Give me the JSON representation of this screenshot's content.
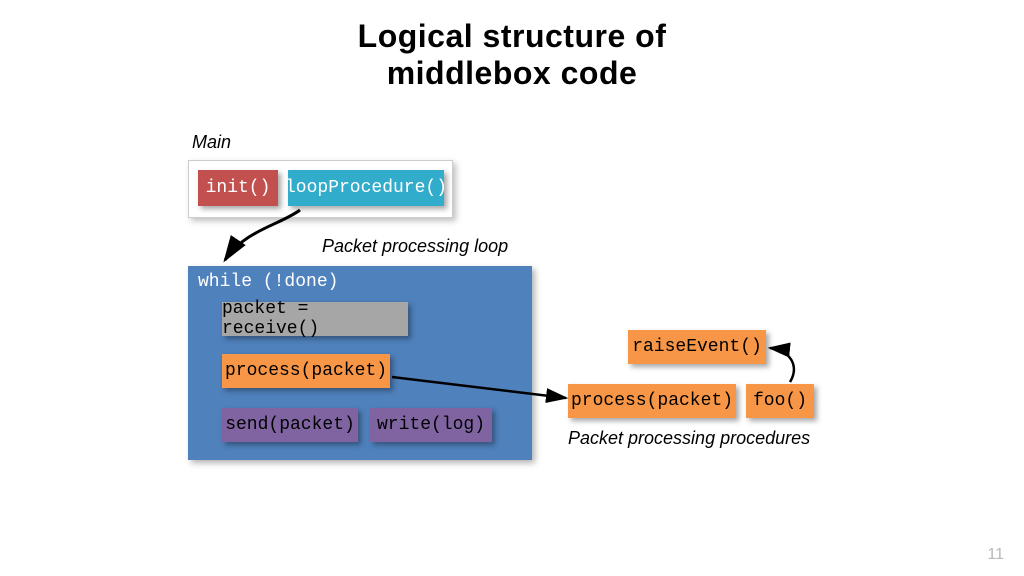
{
  "title_line1": "Logical structure of",
  "title_line2": "middlebox code",
  "title_full": "Logical structure of middlebox code",
  "labels": {
    "main": "Main",
    "loop_label": "Packet processing loop",
    "procs_label": "Packet processing procedures"
  },
  "boxes": {
    "init": "init()",
    "loopProcedure": "loopProcedure()",
    "while": "while (!done)",
    "receive": "packet = receive()",
    "process1": "process(packet)",
    "send": "send(packet)",
    "writelog": "write(log)",
    "process2": "process(packet)",
    "foo": "foo()",
    "raiseEvent": "raiseEvent()"
  },
  "page_number": "11"
}
